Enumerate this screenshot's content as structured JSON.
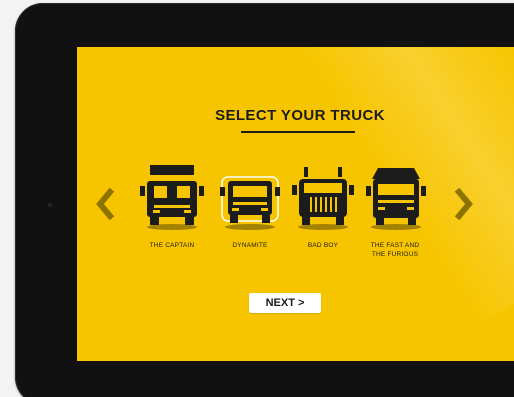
{
  "app": {
    "title": "SELECT YOUR TRUCK",
    "accent_color": "#f7c500",
    "ink_color": "#1c1c1c"
  },
  "navigation": {
    "prev_icon": "chevron-left-icon",
    "next_icon": "chevron-right-icon",
    "next_button_label": "NEXT >"
  },
  "trucks": [
    {
      "label": "THE CAPTAIN",
      "selected": false,
      "icon": "truck-icon"
    },
    {
      "label": "DYNAMITE",
      "selected": true,
      "icon": "truck-icon"
    },
    {
      "label": "BAD BOY",
      "selected": false,
      "icon": "truck-icon"
    },
    {
      "label": "THE FAST AND\nTHE FURIOUS",
      "selected": false,
      "icon": "truck-icon"
    }
  ]
}
